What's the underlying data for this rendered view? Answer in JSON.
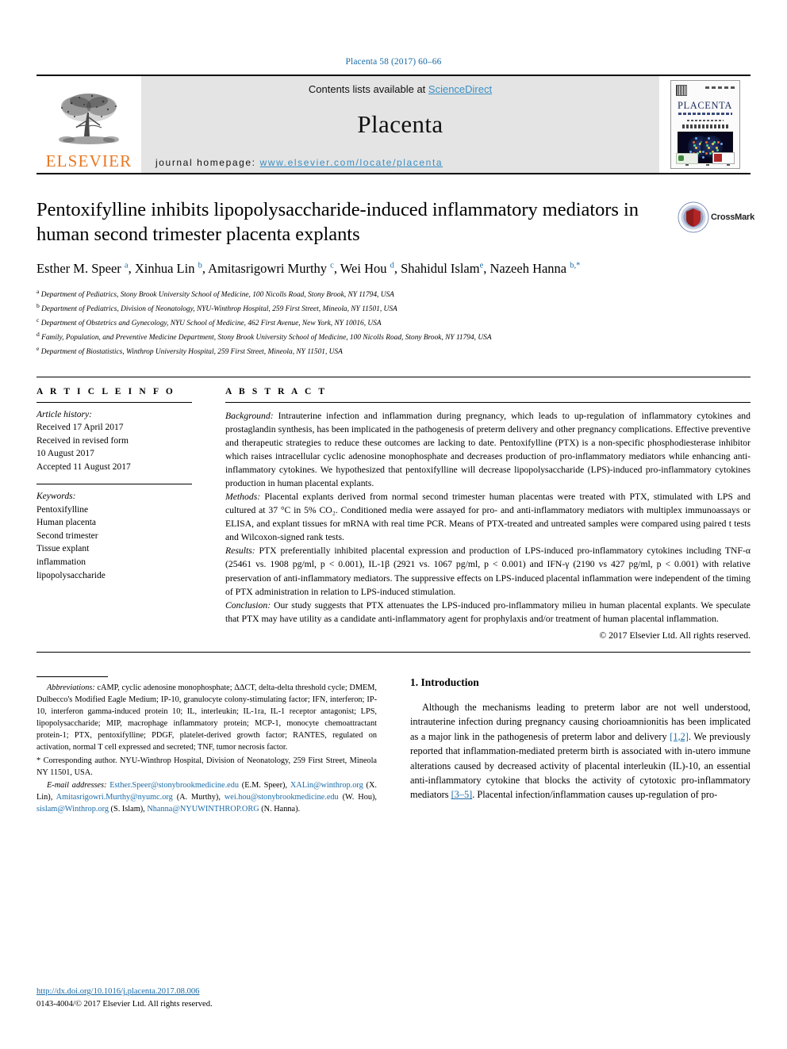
{
  "running_head": "Placenta 58 (2017) 60–66",
  "masthead": {
    "publisher": "ELSEVIER",
    "contents_prefix": "Contents lists available at ",
    "contents_link": "ScienceDirect",
    "journal_name": "Placenta",
    "homepage_prefix": "journal homepage: ",
    "homepage_url": "www.elsevier.com/locate/placenta",
    "cover_title": "PLACENTA"
  },
  "article": {
    "title": "Pentoxifylline inhibits lipopolysaccharide-induced inflammatory mediators in human second trimester placenta explants",
    "crossmark_label": "CrossMark",
    "authors_html": "Esther M. Speer <sup>a</sup>, Xinhua Lin <sup>b</sup>, Amitasrigowri Murthy <sup>c</sup>, Wei Hou <sup>d</sup>, Shahidul Islam<sup>e</sup>, Nazeeh Hanna <sup>b,&#42;</sup>",
    "affiliations": [
      {
        "marker": "a",
        "text": "Department of Pediatrics, Stony Brook University School of Medicine, 100 Nicolls Road, Stony Brook, NY 11794, USA"
      },
      {
        "marker": "b",
        "text": "Department of Pediatrics, Division of Neonatology, NYU-Winthrop Hospital, 259 First Street, Mineola, NY 11501, USA"
      },
      {
        "marker": "c",
        "text": "Department of Obstetrics and Gynecology, NYU School of Medicine, 462 First Avenue, New York, NY 10016, USA"
      },
      {
        "marker": "d",
        "text": "Family, Population, and Preventive Medicine Department, Stony Brook University School of Medicine, 100 Nicolls Road, Stony Brook, NY 11794, USA"
      },
      {
        "marker": "e",
        "text": "Department of Biostatistics, Winthrop University Hospital, 259 First Street, Mineola, NY 11501, USA"
      }
    ]
  },
  "article_info": {
    "heading": "A R T I C L E  I N F O",
    "history_label": "Article history:",
    "history": [
      "Received 17 April 2017",
      "Received in revised form",
      "10 August 2017",
      "Accepted 11 August 2017"
    ],
    "keywords_label": "Keywords:",
    "keywords": [
      "Pentoxifylline",
      "Human placenta",
      "Second trimester",
      "Tissue explant",
      "inflammation",
      "lipopolysaccharide"
    ]
  },
  "abstract": {
    "heading": "A B S T R A C T",
    "sections": [
      {
        "label": "Background:",
        "text": " Intrauterine infection and inflammation during pregnancy, which leads to up-regulation of inflammatory cytokines and prostaglandin synthesis, has been implicated in the pathogenesis of preterm delivery and other pregnancy complications. Effective preventive and therapeutic strategies to reduce these outcomes are lacking to date. Pentoxifylline (PTX) is a non-specific phosphodiesterase inhibitor which raises intracellular cyclic adenosine monophosphate and decreases production of pro-inflammatory mediators while enhancing anti-inflammatory cytokines. We hypothesized that pentoxifylline will decrease lipopolysaccharide (LPS)-induced pro-inflammatory cytokines production in human placental explants."
      },
      {
        "label": "Methods:",
        "text": " Placental explants derived from normal second trimester human placentas were treated with PTX, stimulated with LPS and cultured at 37 °C in 5% CO₂. Conditioned media were assayed for pro- and anti-inflammatory mediators with multiplex immunoassays or ELISA, and explant tissues for mRNA with real time PCR. Means of PTX-treated and untreated samples were compared using paired t tests and Wilcoxon-signed rank tests."
      },
      {
        "label": "Results:",
        "text": " PTX preferentially inhibited placental expression and production of LPS-induced pro-inflammatory cytokines including TNF-α (25461 vs. 1908 pg/ml, p < 0.001), IL-1β (2921 vs. 1067 pg/ml, p < 0.001) and IFN-γ (2190 vs 427 pg/ml, p < 0.001) with relative preservation of anti-inflammatory mediators. The suppressive effects on LPS-induced placental inflammation were independent of the timing of PTX administration in relation to LPS-induced stimulation."
      },
      {
        "label": "Conclusion:",
        "text": " Our study suggests that PTX attenuates the LPS-induced pro-inflammatory milieu in human placental explants. We speculate that PTX may have utility as a candidate anti-inflammatory agent for prophylaxis and/or treatment of human placental inflammation."
      }
    ],
    "copyright": "© 2017 Elsevier Ltd. All rights reserved."
  },
  "footnotes": {
    "abbreviations_label": "Abbreviations:",
    "abbreviations_text": " cAMP, cyclic adenosine monophosphate; ΔΔCT, delta-delta threshold cycle; DMEM, Dulbecco's Modified Eagle Medium; IP-10, granulocyte colony-stimulating factor; IFN, interferon; IP-10, interferon gamma-induced protein 10; IL, interleukin; IL-1ra, IL-1 receptor antagonist; LPS, lipopolysaccharide; MIP, macrophage inflammatory protein; MCP-1, monocyte chemoattractant protein-1; PTX, pentoxifylline; PDGF, platelet-derived growth factor; RANTES, regulated on activation, normal T cell expressed and secreted; TNF, tumor necrosis factor.",
    "corresponding_marker": "*",
    "corresponding_text": " Corresponding author. NYU-Winthrop Hospital, Division of Neonatology, 259 First Street, Mineola NY 11501, USA.",
    "email_label": "E-mail addresses:",
    "emails": [
      {
        "address": "Esther.Speer@stonybrookmedicine.edu",
        "person": "(E.M. Speer)"
      },
      {
        "address": "XALin@winthrop.org",
        "person": "(X. Lin)"
      },
      {
        "address": "Amitasrigowri.Murthy@nyumc.org",
        "person": "(A. Murthy)"
      },
      {
        "address": "wei.hou@stonybrookmedicine.edu",
        "person": "(W. Hou)"
      },
      {
        "address": "sislam@Winthrop.org",
        "person": "(S. Islam)"
      },
      {
        "address": "Nhanna@NYUWINTHROP.ORG",
        "person": "(N. Hanna)"
      }
    ],
    "doi": "http://dx.doi.org/10.1016/j.placenta.2017.08.006",
    "issn_line": "0143-4004/© 2017 Elsevier Ltd. All rights reserved."
  },
  "introduction": {
    "heading": "1. Introduction",
    "paragraph_1": "Although the mechanisms leading to preterm labor are not well understood, intrauterine infection during pregnancy causing chorioamnionitis has been implicated as a major link in the pathogenesis of preterm labor and delivery ",
    "ref_1": "[1,2]",
    "paragraph_1b": ". We previously reported that inflammation-mediated preterm birth is associated with in-utero immune alterations caused by decreased activity of placental interleukin (IL)-10, an essential anti-inflammatory cytokine that blocks the activity of cytotoxic pro-inflammatory mediators ",
    "ref_2": "[3–5]",
    "paragraph_1c": ". Placental infection/inflammation causes up-regulation of pro-"
  },
  "colors": {
    "link": "#1a6ba6",
    "elsevier_orange": "#E87722",
    "banner_grey": "#e4e4e4"
  }
}
